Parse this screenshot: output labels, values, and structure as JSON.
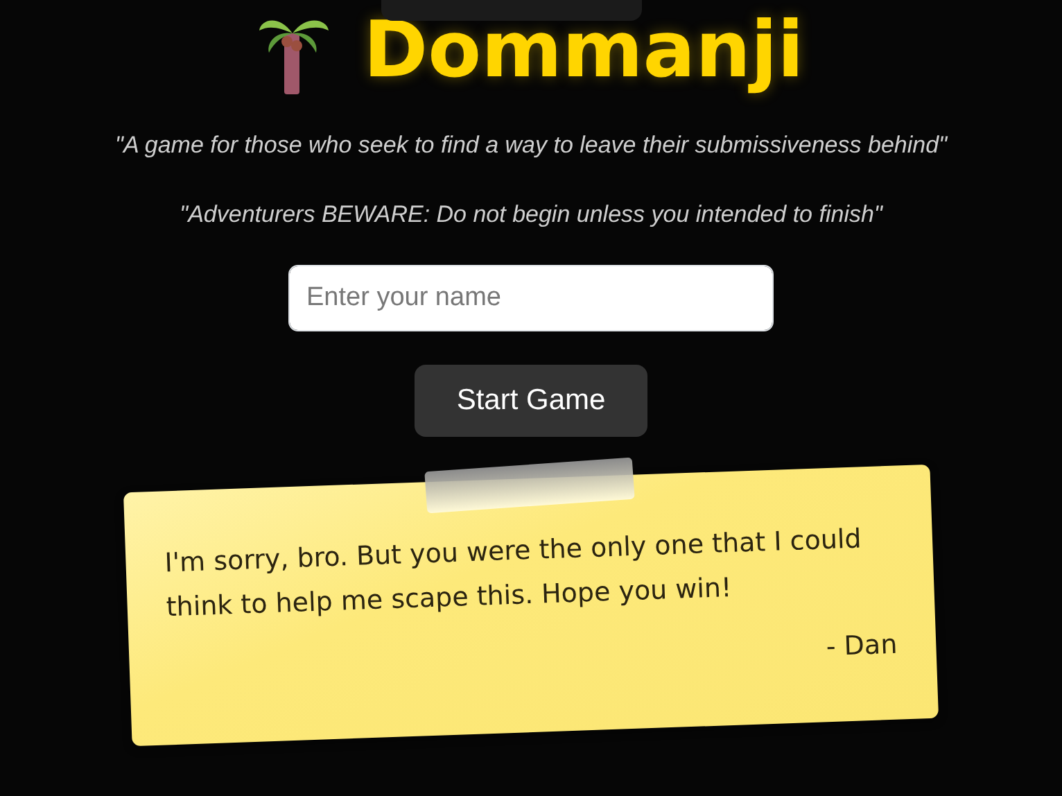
{
  "title": "Dommanji",
  "taglines": [
    "\"A game for those who seek to find a way to leave their submissiveness behind\"",
    "\"Adventurers BEWARE: Do not begin unless you intended to finish\""
  ],
  "name_field": {
    "placeholder": "Enter your name"
  },
  "start_button": "Start Game",
  "note": {
    "message": "I'm sorry, bro. But you were the only one that I could think to help me scape this. Hope you win!",
    "signature": "- Dan"
  }
}
